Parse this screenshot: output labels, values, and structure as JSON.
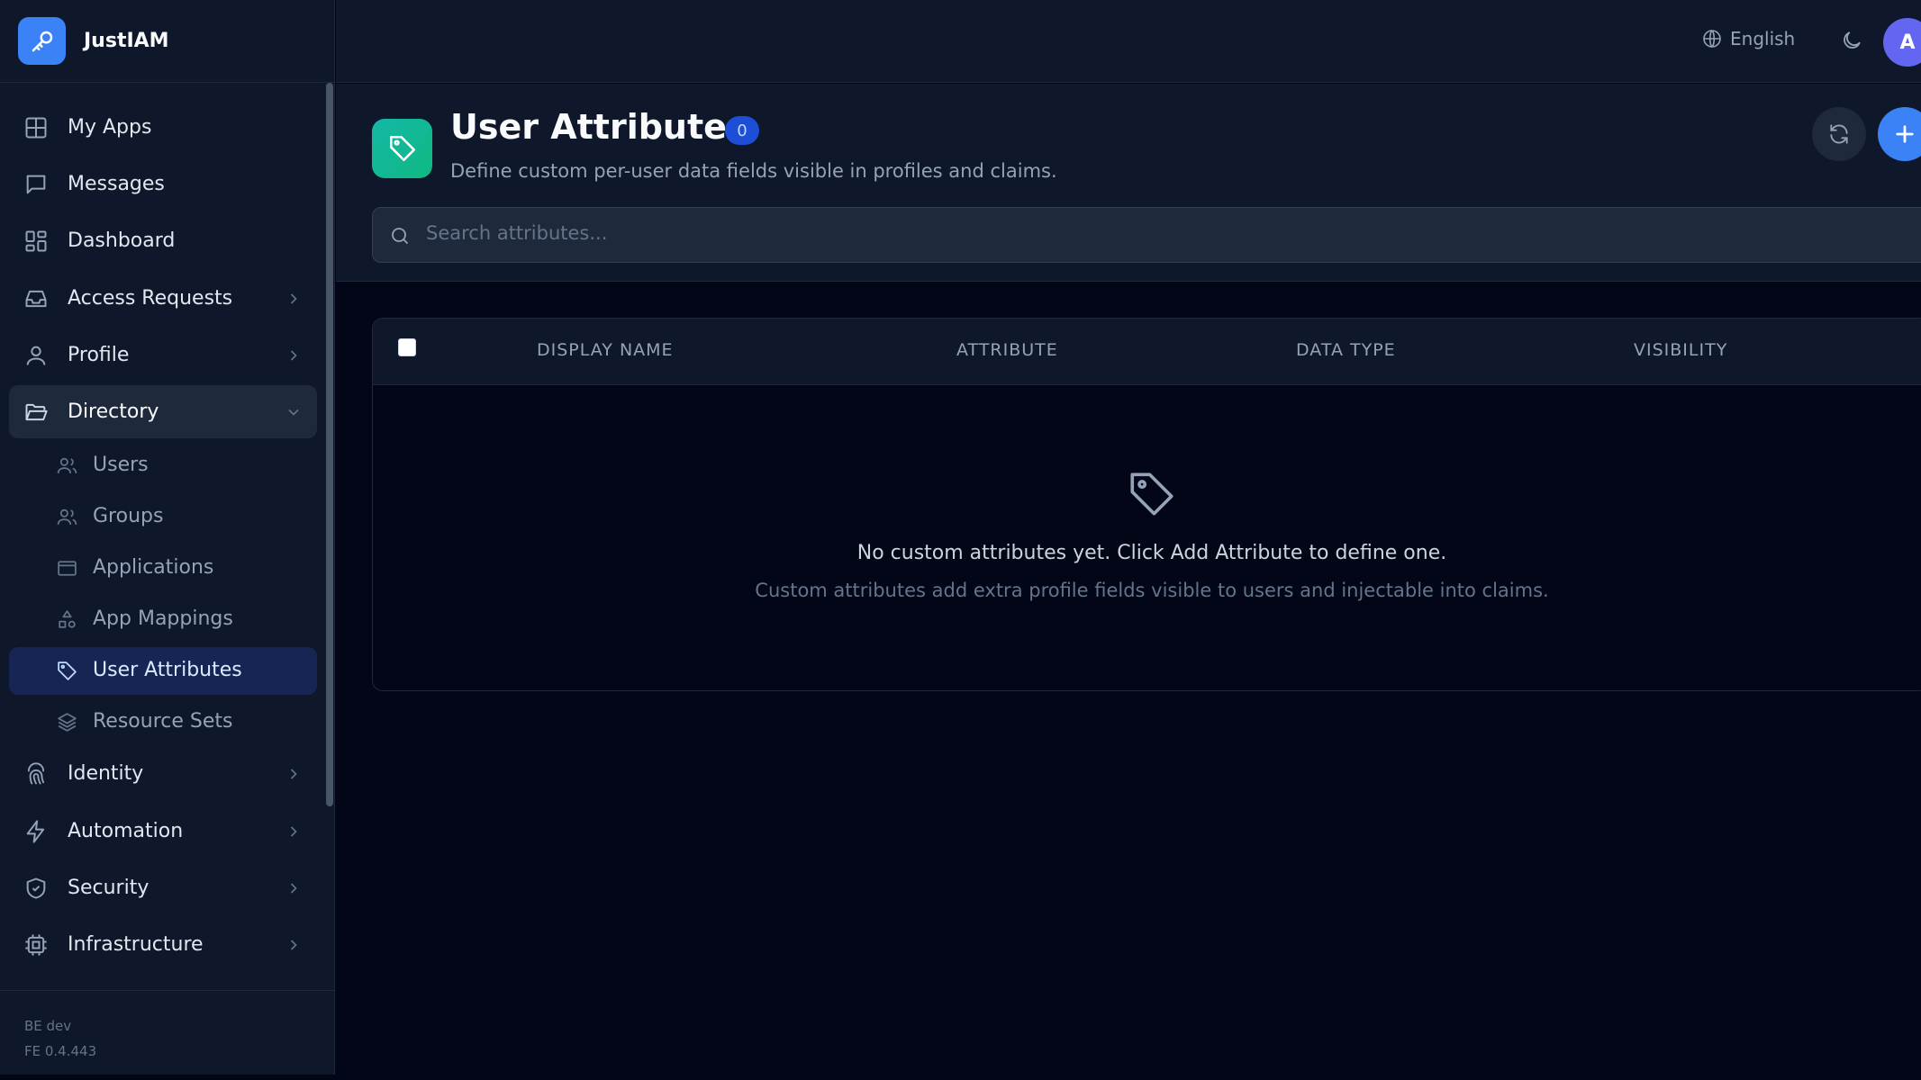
{
  "app": {
    "name": "JustIAM",
    "logo_icon": "key-icon",
    "accent": "#3b82f6"
  },
  "topbar": {
    "language": "English",
    "theme_icon": "moon-icon",
    "avatar_initial": "A"
  },
  "sidebar": {
    "items": [
      {
        "label": "My Apps",
        "icon": "grid-icon"
      },
      {
        "label": "Messages",
        "icon": "message-icon"
      },
      {
        "label": "Dashboard",
        "icon": "dashboard-icon"
      },
      {
        "label": "Access Requests",
        "icon": "inbox-icon",
        "expandable": true
      },
      {
        "label": "Profile",
        "icon": "user-icon",
        "expandable": true
      },
      {
        "label": "Directory",
        "icon": "folder-open-icon",
        "expanded": true
      },
      {
        "label": "Identity",
        "icon": "fingerprint-icon",
        "expandable": true
      },
      {
        "label": "Automation",
        "icon": "lightning-icon",
        "expandable": true
      },
      {
        "label": "Security",
        "icon": "shield-icon",
        "expandable": true
      },
      {
        "label": "Infrastructure",
        "icon": "cpu-icon",
        "expandable": true
      }
    ],
    "directory_children": [
      {
        "label": "Users",
        "icon": "users-icon"
      },
      {
        "label": "Groups",
        "icon": "groups-icon"
      },
      {
        "label": "Applications",
        "icon": "window-icon"
      },
      {
        "label": "App Mappings",
        "icon": "shapes-icon"
      },
      {
        "label": "User Attributes",
        "icon": "tag-icon",
        "active": true
      },
      {
        "label": "Resource Sets",
        "icon": "layers-icon"
      }
    ],
    "footer": {
      "be": "BE dev",
      "fe": "FE 0.4.443"
    }
  },
  "page": {
    "title": "User Attributes",
    "count": "0",
    "subtitle": "Define custom per-user data fields visible in profiles and claims.",
    "icon": "tag-icon",
    "icon_color": "#14b8a6"
  },
  "search": {
    "placeholder": "Search attributes..."
  },
  "table": {
    "columns": [
      "DISPLAY NAME",
      "ATTRIBUTE",
      "DATA TYPE",
      "VISIBILITY"
    ],
    "rows": []
  },
  "empty_state": {
    "icon": "tag-icon",
    "title": "No custom attributes yet. Click Add Attribute to define one.",
    "text": "Custom attributes add extra profile fields visible to users and injectable into claims."
  }
}
